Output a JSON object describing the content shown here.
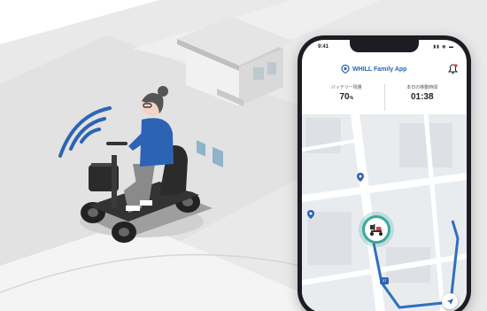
{
  "status_bar": {
    "time": "9:41",
    "icons": "▮▮ ◉ ▬"
  },
  "app": {
    "title": "WHILL Family App",
    "logo_icon": "whill-logo-icon",
    "notification_icon": "bell-icon"
  },
  "stats": [
    {
      "label": "バッテリー残量",
      "value": "70",
      "unit": "%"
    },
    {
      "label": "本日の移動時間",
      "value": "01:38",
      "unit": ""
    }
  ],
  "map": {
    "road_badge": "37",
    "marker_icon": "wheelchair-scooter-icon",
    "locate_icon": "location-arrow-icon"
  },
  "colors": {
    "accent": "#2d63b5",
    "route": "#2f6fc0",
    "marker_ring": "#3aa89b"
  }
}
